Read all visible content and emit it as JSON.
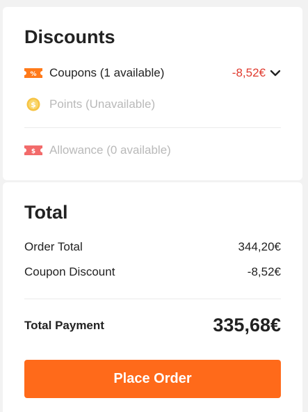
{
  "discounts": {
    "title": "Discounts",
    "coupons": {
      "label": "Coupons (1 available)",
      "amount": "-8,52€"
    },
    "points": {
      "label": "Points (Unavailable)"
    },
    "allowance": {
      "label": "Allowance (0 available)"
    }
  },
  "total": {
    "title": "Total",
    "order_total_label": "Order Total",
    "order_total_value": "344,20€",
    "coupon_discount_label": "Coupon Discount",
    "coupon_discount_value": "-8,52€",
    "total_payment_label": "Total Payment",
    "total_payment_value": "335,68€"
  },
  "actions": {
    "place_order_label": "Place Order"
  },
  "colors": {
    "accent": "#ff6a1a",
    "discount_red": "#e03a2e",
    "disabled_text": "#b9b9b9"
  },
  "icons": {
    "coupon": "coupon-percent-icon",
    "points": "coin-icon",
    "allowance": "allowance-ticket-icon",
    "expand": "chevron-down-icon"
  }
}
